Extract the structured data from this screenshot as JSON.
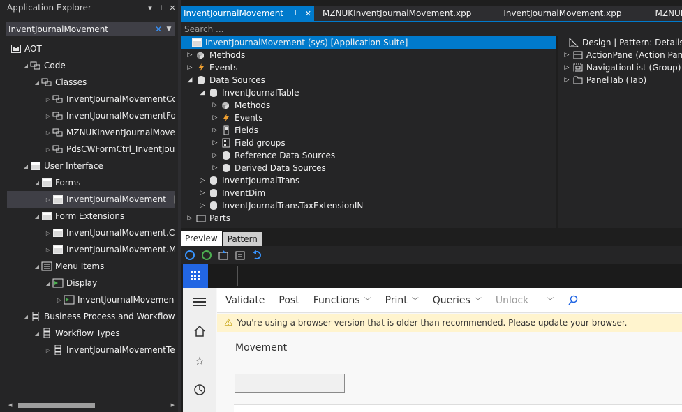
{
  "explorer": {
    "title": "Application Explorer",
    "search_value": "InventJournalMovement",
    "items": [
      {
        "label": "AOT"
      },
      {
        "label": "Code"
      },
      {
        "label": "Classes"
      },
      {
        "label": "InventJournalMovementCos"
      },
      {
        "label": "InventJournalMovementForr"
      },
      {
        "label": "MZNUKInventJournalMoven"
      },
      {
        "label": "PdsCWFormCtrl_InventJourn"
      },
      {
        "label": "User Interface"
      },
      {
        "label": "Forms"
      },
      {
        "label": "InventJournalMovement",
        "suffix": "[A"
      },
      {
        "label": "Form Extensions"
      },
      {
        "label": "InventJournalMovement.Cos"
      },
      {
        "label": "InventJournalMovement.MZ"
      },
      {
        "label": "Menu Items"
      },
      {
        "label": "Display"
      },
      {
        "label": "InventJournalMovementD"
      },
      {
        "label": "Business Process and Workflow"
      },
      {
        "label": "Workflow Types"
      },
      {
        "label": "InventJournalMovementTem"
      }
    ]
  },
  "tabs": [
    {
      "label": "InventJournalMovement"
    },
    {
      "label": "MZNUKInventJournalMovement.xpp"
    },
    {
      "label": "InventJournalMovement.xpp"
    },
    {
      "label": "MZNUKBuildings"
    }
  ],
  "designer": {
    "search_placeholder": "Search ...",
    "nodes": [
      {
        "label": "InventJournalMovement (sys) [Application Suite]"
      },
      {
        "label": "Methods"
      },
      {
        "label": "Events"
      },
      {
        "label": "Data Sources"
      },
      {
        "label": "InventJournalTable"
      },
      {
        "label": "Methods"
      },
      {
        "label": "Events"
      },
      {
        "label": "Fields"
      },
      {
        "label": "Field groups"
      },
      {
        "label": "Reference Data Sources"
      },
      {
        "label": "Derived Data Sources"
      },
      {
        "label": "InventJournalTrans"
      },
      {
        "label": "InventDim"
      },
      {
        "label": "InventJournalTransTaxExtensionIN"
      },
      {
        "label": "Parts"
      }
    ],
    "design_nodes": [
      {
        "label": "Design | Pattern: Details Tra"
      },
      {
        "label": "ActionPane (Action Pan"
      },
      {
        "label": "NavigationList (Group)"
      },
      {
        "label": "PanelTab (Tab)"
      }
    ]
  },
  "preview_tabs": [
    {
      "label": "Preview"
    },
    {
      "label": "Pattern"
    }
  ],
  "preview": {
    "actions": [
      {
        "label": "Validate"
      },
      {
        "label": "Post"
      },
      {
        "label": "Functions"
      },
      {
        "label": "Print"
      },
      {
        "label": "Queries"
      },
      {
        "label": "Unlock"
      }
    ],
    "warning": "You're using a browser version that is older than recommended. Please update your browser.",
    "caption": "Movement"
  },
  "colors": {
    "accent": "#007acc",
    "d365_blue": "#2266e3",
    "warning_bg": "#fff4ce"
  }
}
